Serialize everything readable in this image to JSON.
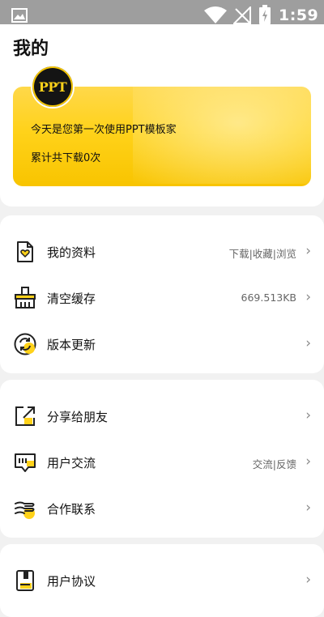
{
  "status_bar": {
    "time": "1:59"
  },
  "page_title": "我的",
  "banner": {
    "logo_text": "PPT",
    "line1": "今天是您第一次使用PPT模板家",
    "line2": "累计共下载0次",
    "color": "#ffd21a"
  },
  "menu_groups": [
    {
      "items": [
        {
          "label": "我的资料",
          "detail": "下载|收藏|浏览",
          "icon": "document-icon"
        },
        {
          "label": "清空缓存",
          "detail": "669.513KB",
          "icon": "broom-icon"
        },
        {
          "label": "版本更新",
          "detail": "",
          "icon": "refresh-icon"
        }
      ]
    },
    {
      "items": [
        {
          "label": "分享给朋友",
          "detail": "",
          "icon": "share-icon"
        },
        {
          "label": "用户交流",
          "detail": "交流|反馈",
          "icon": "chat-icon"
        },
        {
          "label": "合作联系",
          "detail": "",
          "icon": "handshake-icon"
        }
      ]
    },
    {
      "items": [
        {
          "label": "用户协议",
          "detail": "",
          "icon": "agreement-icon"
        }
      ]
    }
  ],
  "chevron": "›",
  "accent": "#ffd21a"
}
